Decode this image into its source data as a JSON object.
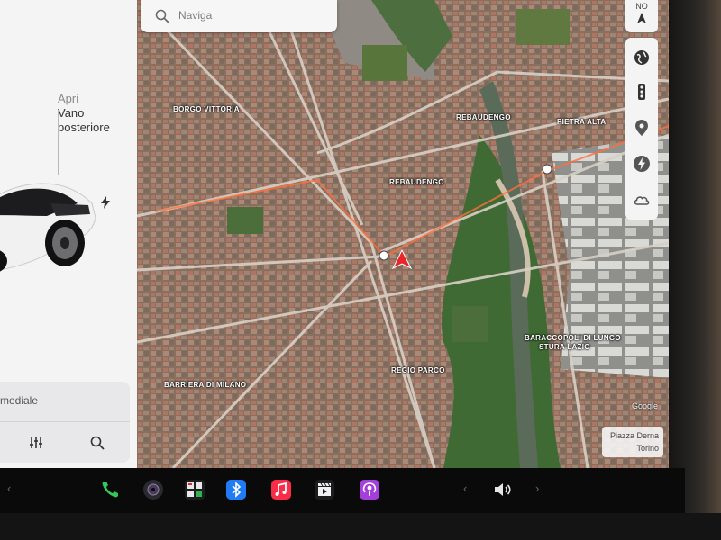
{
  "car_panel": {
    "trunk_action": "Apri",
    "trunk_name_line1": "Vano",
    "trunk_name_line2": "posteriore",
    "media_text": "mediale",
    "charge_icon": "lightning-icon",
    "eq_icon": "equalizer-icon",
    "search_icon": "search-icon"
  },
  "map": {
    "search_placeholder": "Naviga",
    "compass": "NO",
    "tools": [
      "globe-icon",
      "traffic-light-icon",
      "location-pin-icon",
      "charging-bolt-icon",
      "weather-cloud-icon"
    ],
    "places": [
      {
        "id": "borgo-vittoria",
        "label": "BORGO VITTORIA"
      },
      {
        "id": "rebaudengo-top",
        "label": "REBAUDENGO"
      },
      {
        "id": "rebaudengo-mid",
        "label": "REBAUDENGO"
      },
      {
        "id": "pietra-alta",
        "label": "PIETRA ALTA"
      },
      {
        "id": "barriera-milano",
        "label": "BARRIERA DI MILANO"
      },
      {
        "id": "regio-parco",
        "label": "REGIO PARCO"
      },
      {
        "id": "baraccopoli-1",
        "label": "BARACCOPOLI DI LUNGO"
      },
      {
        "id": "baraccopoli-2",
        "label": "STURA LAZIO"
      }
    ],
    "credit_line1": "Piazza Derna",
    "credit_line2": "Torino",
    "google_label": "Google",
    "colors": {
      "route": "#ff6f3c",
      "arrow": "#e8252b",
      "parks": "#3f6a33"
    }
  },
  "dock": {
    "apps": [
      {
        "id": "phone",
        "icon": "phone-icon",
        "color": "#34c759"
      },
      {
        "id": "camera",
        "icon": "camera-icon",
        "color": "#2a2a2e"
      },
      {
        "id": "toybox",
        "icon": "calendar-icon",
        "color": "#1d1d1f"
      },
      {
        "id": "bluetooth",
        "icon": "bluetooth-icon",
        "color": "#1f7cf5"
      },
      {
        "id": "music",
        "icon": "music-icon",
        "color": "#fa2d48"
      },
      {
        "id": "theater",
        "icon": "theater-icon",
        "color": "#1d1d1f"
      },
      {
        "id": "podcasts",
        "icon": "podcasts-icon",
        "color": "#a440d9"
      }
    ],
    "volume_icon": "volume-icon"
  }
}
